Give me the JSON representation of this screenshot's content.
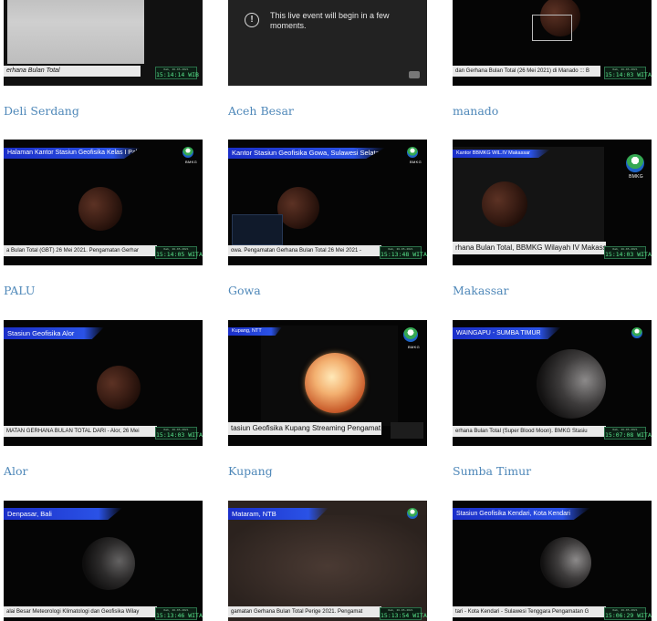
{
  "cards": [
    {
      "title": "Deli Serdang",
      "ticker": "erhana Bulan Total",
      "clock": "15:14:14 WIB"
    },
    {
      "title": "Aceh Besar",
      "player_message": "This live event will begin in a few moments."
    },
    {
      "title": "manado",
      "ticker": "dan Gerhana Bulan Total (26 Mei 2021) di Manado ::: B",
      "clock": "15:14:03 WITA"
    },
    {
      "title": "PALU",
      "top_label": "Halaman Kantor Stasiun Geofisika Kelas I Palu",
      "ticker": "a Bulan Total (GBT) 26 Mei 2021.  Pengamatan Gerhar",
      "clock": "15:14:05 WITA"
    },
    {
      "title": "Gowa",
      "top_label": "Kantor Stasiun Geofisika Gowa, Sulawesi Selatan",
      "ticker": "owa.  Pengamatan Gerhana Bulan Total 26 Mei 2021 -",
      "clock": "15:13:48 WITA"
    },
    {
      "title": "Makassar",
      "top_label": "Kantor BBMKG WIL.IV Makassar",
      "ticker": "rhana Bulan Total, BBMKG Wilayah IV Makass",
      "clock": "15:14:03 WITA"
    },
    {
      "title": "Alor",
      "top_label": "Stasiun Geofisika Alor",
      "ticker": "MATAN GERHANA BULAN TOTAL DARI - Alor, 26 Mei",
      "clock": "15:14:03 WITA"
    },
    {
      "title": "Kupang",
      "top_label": "Kupang, NTT",
      "ticker": "tasiun Geofisika Kupang Streaming Pengamat"
    },
    {
      "title": "Sumba Timur",
      "top_label": "WAINGAPU - SUMBA TIMUR",
      "ticker": "erhana Bulan Total (Super Blood Moon). BMKG Stasiu",
      "clock": "15:07:08 WITA"
    },
    {
      "title": "",
      "top_label": "Denpasar, Bali",
      "ticker": "alai Besar Meteorologi Klimatologi dan Geofisika Wilay",
      "clock": "15:13:46 WITA"
    },
    {
      "title": "",
      "top_label": "Mataram, NTB",
      "ticker": "gamatan Gerhana Bulan Total Perige 2021. Pengamat",
      "clock": "15:13:54 WITA"
    },
    {
      "title": "",
      "top_label": "Stasiun Geofisika Kendari, Kota Kendari",
      "ticker": "tari - Kota Kendari - Sulawesi Tenggara Pengamatan G",
      "clock": "15:06:29 WITA"
    }
  ],
  "bmkg_logo_text": "BMKG",
  "colors": {
    "title_link": "#4f88b9",
    "label_blue": "#2a52e6",
    "clock_green": "#58e28a"
  }
}
